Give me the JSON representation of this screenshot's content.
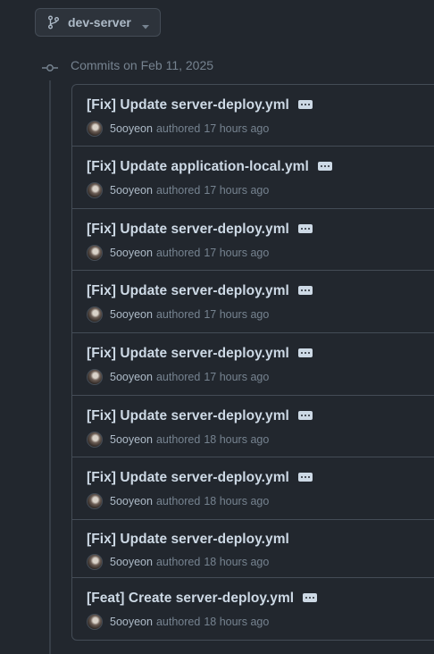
{
  "branch": {
    "name": "dev-server"
  },
  "date_group": {
    "label": "Commits on Feb 11, 2025"
  },
  "commits": [
    {
      "title": "[Fix] Update server-deploy.yml",
      "author": "5ooyeon",
      "authored": "authored",
      "time": "17 hours ago",
      "has_ellipsis": true
    },
    {
      "title": "[Fix] Update application-local.yml",
      "author": "5ooyeon",
      "authored": "authored",
      "time": "17 hours ago",
      "has_ellipsis": true
    },
    {
      "title": "[Fix] Update server-deploy.yml",
      "author": "5ooyeon",
      "authored": "authored",
      "time": "17 hours ago",
      "has_ellipsis": true
    },
    {
      "title": "[Fix] Update server-deploy.yml",
      "author": "5ooyeon",
      "authored": "authored",
      "time": "17 hours ago",
      "has_ellipsis": true
    },
    {
      "title": "[Fix] Update server-deploy.yml",
      "author": "5ooyeon",
      "authored": "authored",
      "time": "17 hours ago",
      "has_ellipsis": true
    },
    {
      "title": "[Fix] Update server-deploy.yml",
      "author": "5ooyeon",
      "authored": "authored",
      "time": "18 hours ago",
      "has_ellipsis": true
    },
    {
      "title": "[Fix] Update server-deploy.yml",
      "author": "5ooyeon",
      "authored": "authored",
      "time": "18 hours ago",
      "has_ellipsis": true
    },
    {
      "title": "[Fix] Update server-deploy.yml",
      "author": "5ooyeon",
      "authored": "authored",
      "time": "18 hours ago",
      "has_ellipsis": false
    },
    {
      "title": "[Feat] Create server-deploy.yml",
      "author": "5ooyeon",
      "authored": "authored",
      "time": "18 hours ago",
      "has_ellipsis": true
    }
  ]
}
